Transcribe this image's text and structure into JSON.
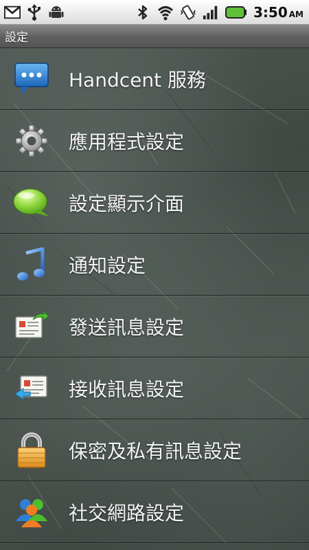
{
  "status_bar": {
    "left_icons": [
      "gmail-icon",
      "usb-icon",
      "android-icon"
    ],
    "right_icons": [
      "bluetooth-icon",
      "wifi-icon",
      "vibrate-icon",
      "signal-icon",
      "battery-icon"
    ],
    "time": "3:50",
    "ampm": "AM"
  },
  "titlebar": {
    "title": "設定"
  },
  "menu": {
    "items": [
      {
        "label": "Handcent 服務",
        "icon": "chat-bubble-icon"
      },
      {
        "label": "應用程式設定",
        "icon": "gear-icon"
      },
      {
        "label": "設定顯示介面",
        "icon": "speech-bubble-icon"
      },
      {
        "label": "通知設定",
        "icon": "music-note-icon"
      },
      {
        "label": "發送訊息設定",
        "icon": "send-message-icon"
      },
      {
        "label": "接收訊息設定",
        "icon": "receive-message-icon"
      },
      {
        "label": "保密及私有訊息設定",
        "icon": "lock-icon"
      },
      {
        "label": "社交網路設定",
        "icon": "people-icon"
      }
    ]
  },
  "colors": {
    "battery": "#5fc13a",
    "label_text": "#f4f4f4",
    "titlebar_text": "#ffffff"
  }
}
